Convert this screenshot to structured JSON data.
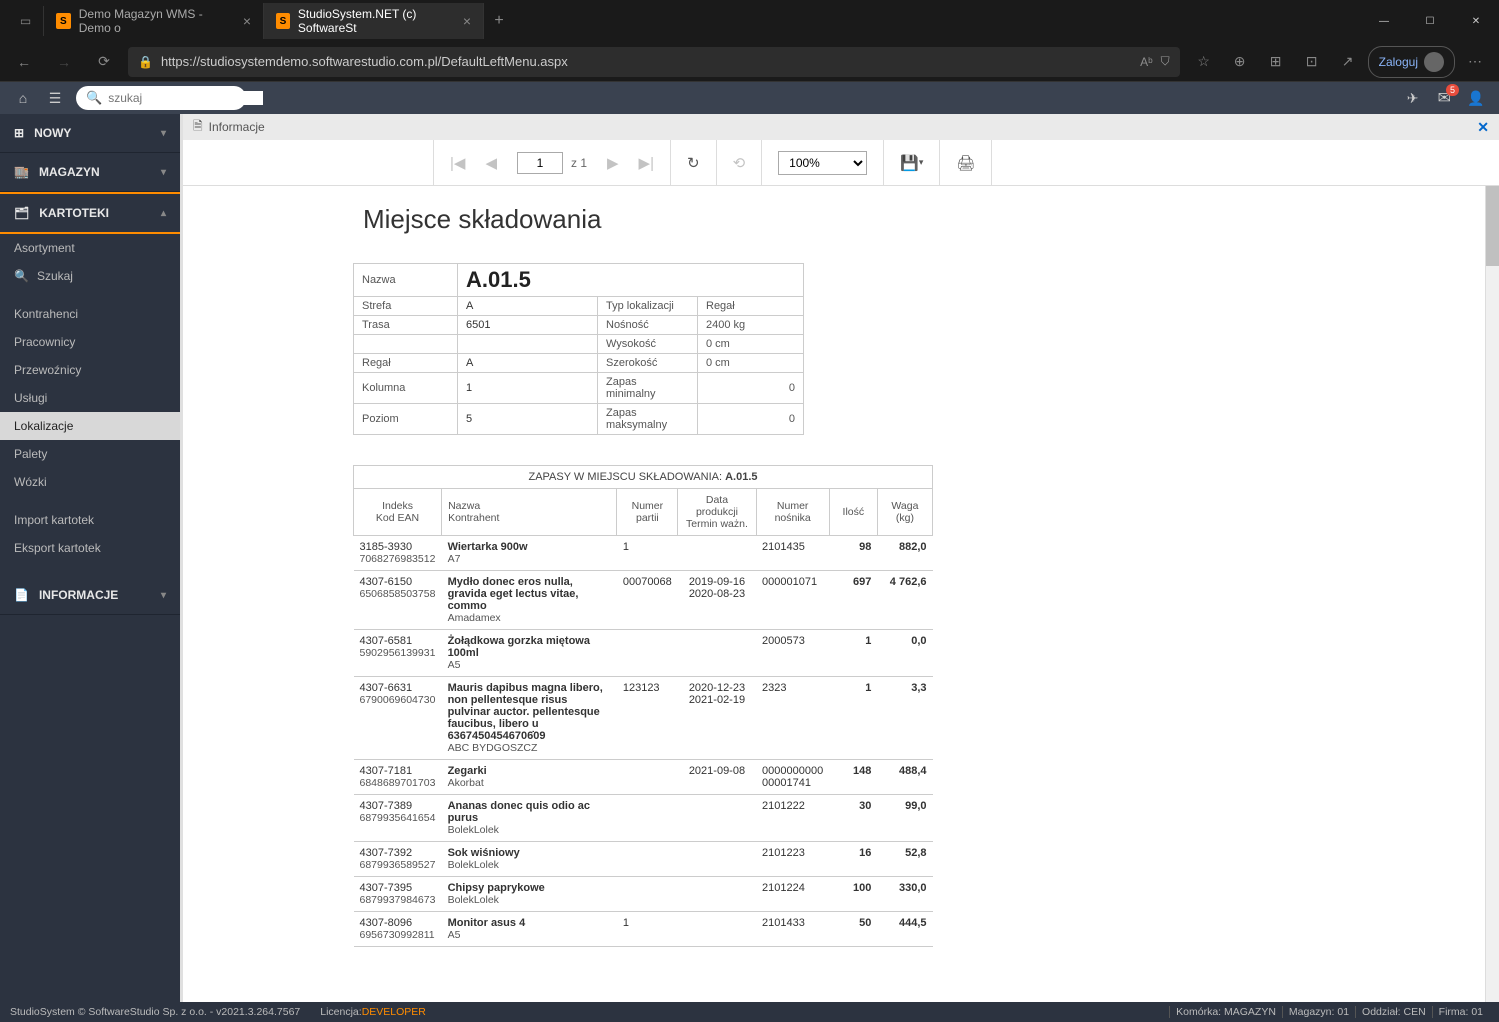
{
  "browser": {
    "tab1": "Demo Magazyn WMS - Demo o",
    "tab2": "StudioSystem.NET (c) SoftwareSt",
    "url": "https://studiosystemdemo.softwarestudio.com.pl/DefaultLeftMenu.aspx",
    "login": "Zaloguj"
  },
  "topbar": {
    "search_placeholder": "szukaj",
    "mail_count": "5"
  },
  "sidebar": {
    "nowy": "NOWY",
    "magazyn": "MAGAZYN",
    "kartoteki": "KARTOTEKI",
    "items": {
      "asortyment": "Asortyment",
      "szukaj": "Szukaj",
      "kontrahenci": "Kontrahenci",
      "pracownicy": "Pracownicy",
      "przewoznicy": "Przewoźnicy",
      "uslugi": "Usługi",
      "lokalizacje": "Lokalizacje",
      "palety": "Palety",
      "wozki": "Wózki",
      "import": "Import kartotek",
      "eksport": "Eksport kartotek"
    },
    "informacje": "INFORMACJE"
  },
  "panel": {
    "title": "Informacje"
  },
  "toolbar": {
    "page": "1",
    "page_of": "z 1",
    "zoom": "100%"
  },
  "report": {
    "title": "Miejsce składowania",
    "labels": {
      "nazwa": "Nazwa",
      "strefa": "Strefa",
      "trasa": "Trasa",
      "regal": "Regał",
      "kolumna": "Kolumna",
      "poziom": "Poziom",
      "typlok": "Typ lokalizacji",
      "nosnosc": "Nośność",
      "wysokosc": "Wysokość",
      "szerokosc": "Szerokość",
      "zapasmin": "Zapas minimalny",
      "zapasmax": "Zapas maksymalny"
    },
    "values": {
      "nazwa": "A.01.5",
      "strefa": "A",
      "trasa": "6501",
      "regal": "A",
      "kolumna": "1",
      "poziom": "5",
      "typlok": "Regał",
      "nosnosc": "2400 kg",
      "wysokosc": "0 cm",
      "szerokosc": "0 cm",
      "zapasmin": "0",
      "zapasmax": "0"
    }
  },
  "stock": {
    "caption_prefix": "ZAPASY W MIEJSCU SKŁADOWANIA: ",
    "caption_id": "A.01.5",
    "headers": {
      "indeks1": "Indeks",
      "indeks2": "Kod EAN",
      "nazwa1": "Nazwa",
      "nazwa2": "Kontrahent",
      "partia1": "Numer",
      "partia2": "partii",
      "data1": "Data produkcji",
      "data2": "Termin ważn.",
      "nosnik1": "Numer",
      "nosnik2": "nośnika",
      "ilosc": "Ilość",
      "waga": "Waga (kg)"
    },
    "rows": [
      {
        "idx": "3185-3930",
        "ean": "7068276983512",
        "name": "Wiertarka 900w",
        "k": "A7",
        "partia": "1",
        "d1": "",
        "d2": "",
        "nos": "2101435",
        "il": "98",
        "w": "882,0"
      },
      {
        "idx": "4307-6150",
        "ean": "6506858503758",
        "name": "Mydło donec eros nulla, gravida eget lectus vitae, commo",
        "k": "Amadamex",
        "partia": "00070068",
        "d1": "2019-09-16",
        "d2": "2020-08-23",
        "nos": "000001071",
        "il": "697",
        "w": "4 762,6"
      },
      {
        "idx": "4307-6581",
        "ean": "5902956139931",
        "name": "Żołądkowa gorzka miętowa 100ml",
        "k": "A5",
        "partia": "",
        "d1": "",
        "d2": "",
        "nos": "2000573",
        "il": "1",
        "w": "0,0"
      },
      {
        "idx": "4307-6631",
        "ean": "6790069604730",
        "name": "Mauris dapibus magna libero, non pellentesque risus pulvinar auctor. pellentesque faucibus, libero u 63674504546706̇09",
        "k": "ABC BYDGOSZCZ",
        "partia": "123123",
        "d1": "2020-12-23",
        "d2": "2021-02-19",
        "nos": "2323",
        "il": "1",
        "w": "3,3"
      },
      {
        "idx": "4307-7181",
        "ean": "6848689701703",
        "name": "Zegarki",
        "k": "Akorbat",
        "partia": "",
        "d1": "2021-09-08",
        "d2": "",
        "nos": "0000000000 00001741",
        "il": "148",
        "w": "488,4"
      },
      {
        "idx": "4307-7389",
        "ean": "6879935641654",
        "name": "Ananas donec quis odio ac purus",
        "k": "BolekLolek",
        "partia": "",
        "d1": "",
        "d2": "",
        "nos": "2101222",
        "il": "30",
        "w": "99,0"
      },
      {
        "idx": "4307-7392",
        "ean": "6879936589527",
        "name": "Sok wiśniowy",
        "k": "BolekLolek",
        "partia": "",
        "d1": "",
        "d2": "",
        "nos": "2101223",
        "il": "16",
        "w": "52,8"
      },
      {
        "idx": "4307-7395",
        "ean": "6879937984673",
        "name": "Chipsy paprykowe",
        "k": "BolekLolek",
        "partia": "",
        "d1": "",
        "d2": "",
        "nos": "2101224",
        "il": "100",
        "w": "330,0"
      },
      {
        "idx": "4307-8096",
        "ean": "6956730992811",
        "name": "Monitor asus 4",
        "k": "A5",
        "partia": "1",
        "d1": "",
        "d2": "",
        "nos": "2101433",
        "il": "50",
        "w": "444,5"
      }
    ]
  },
  "footer": {
    "left": "StudioSystem © SoftwareStudio Sp. z o.o. - v2021.3.264.7567",
    "lic_label": "Licencja: ",
    "lic_val": "DEVELOPER",
    "seg1": "Komórka: MAGAZYN",
    "seg2": "Magazyn: 01",
    "seg3": "Oddział: CEN",
    "seg4": "Firma: 01"
  }
}
